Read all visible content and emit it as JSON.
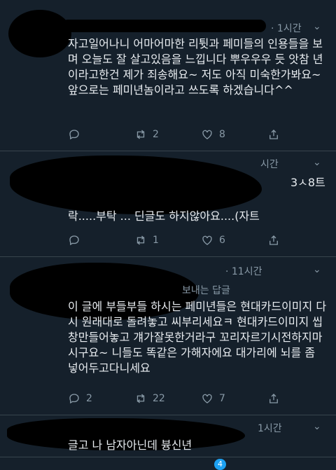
{
  "tweets": [
    {
      "time": "· 1시간",
      "text": "자고일어나니 어마어마한 리튓과 페미들의 인용들을 보며 오늘도 잘 살고있음을 느낍니다 뿌우우우 듯 앗참 년이라고한건 제가 죄송해요~ 저도 아직 미숙한가봐요~ 앞으로는 페미년놈이라고 쓰도록 하겠습니다^^",
      "reply_count": "",
      "retweet_count": "2",
      "like_count": "8"
    },
    {
      "time": "시간",
      "partial_right": "3ㅅ8트",
      "text": "락.....부탁 ... 딘글도 하지않아요....(자트",
      "reply_count": "",
      "retweet_count": "1",
      "like_count": "6"
    },
    {
      "time": "· 11시간",
      "reply_label": "보내는 답글",
      "text": "이 글에 부들부들 하시는 페미년들은 현대카드이미지 다시 원래대로 돌려놓고 씨부리세요ㅋ 현대카드이미지 씹창만들어놓고 걔가잘못한거라구 꼬리자르기시전하지마시구요~ 니들도 똑같은 가해자에요 대가리에 뇌를 좀 넣어두고다니세요",
      "reply_count": "2",
      "retweet_count": "22",
      "like_count": "7"
    },
    {
      "time": "1시간",
      "text": "글고 나 남자아닌데 븅신년"
    }
  ],
  "bottom_badge": "4",
  "colors": {
    "bg": "#15202b",
    "muted": "#8899a6",
    "text": "#e8ecf0",
    "divider": "#38444d",
    "accent": "#1da1f2"
  }
}
